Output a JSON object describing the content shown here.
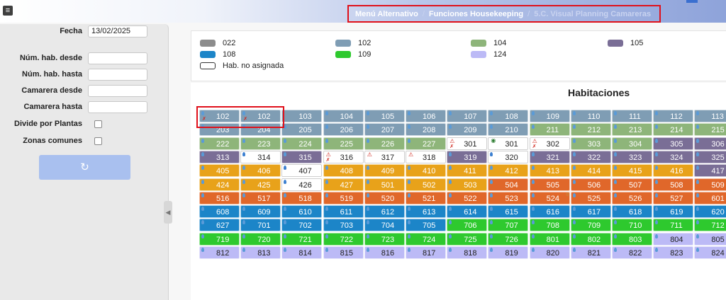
{
  "header": {
    "menu_icon": "hamburger-icon",
    "breadcrumb": [
      "Menú Alternativo",
      "Funciones Housekeeping",
      "5.C. Visual Planning Camareras"
    ],
    "separator": "/"
  },
  "filters": {
    "fecha_label": "Fecha",
    "fecha_value": "13/02/2025",
    "hab_desde_label": "Núm. hab. desde",
    "hab_desde_value": "",
    "hab_hasta_label": "Núm. hab. hasta",
    "hab_hasta_value": "",
    "camarera_desde_label": "Camarera desde",
    "camarera_desde_value": "",
    "camarera_hasta_label": "Camarera hasta",
    "camarera_hasta_value": "",
    "divide_plantas_label": "Divide por Plantas",
    "divide_plantas_checked": false,
    "zonas_comunes_label": "Zonas comunes",
    "zonas_comunes_checked": false,
    "refresh_icon": "refresh-icon",
    "collapse_icon": "chevron-left-icon"
  },
  "legend": [
    {
      "code": "022",
      "color": "#8c8c8c"
    },
    {
      "code": "102",
      "color": "#7f9db4"
    },
    {
      "code": "104",
      "color": "#8eb57a"
    },
    {
      "code": "105",
      "color": "#7a6e96"
    },
    {
      "code": "108",
      "color": "#1c85c8"
    },
    {
      "code": "109",
      "color": "#2ec92e"
    },
    {
      "code": "124",
      "color": "#bcbaf6"
    },
    {
      "code": "Hab. no asignada",
      "color": "#ffffff"
    }
  ],
  "rooms_title": "Habitaciones",
  "palette": {
    "A": "#7f9db4",
    "G": "#8eb57a",
    "P": "#7a6e96",
    "W": "#ffffff",
    "O": "#e8a21a",
    "R": "#e0672a",
    "B": "#1c85c8",
    "N": "#2ec92e",
    "L": "#bcbaf6"
  },
  "rooms": [
    [
      [
        "102",
        "A",
        "dp"
      ],
      [
        "102",
        "A",
        "dp"
      ],
      [
        "103",
        "A",
        ""
      ],
      [
        "104",
        "A",
        "d"
      ],
      [
        "105",
        "A",
        "d"
      ],
      [
        "106",
        "A",
        "d"
      ],
      [
        "107",
        "A",
        "d"
      ],
      [
        "108",
        "A",
        "d"
      ],
      [
        "109",
        "A",
        "d"
      ],
      [
        "110",
        "A",
        "d"
      ],
      [
        "111",
        "A",
        "d"
      ],
      [
        "112",
        "A",
        "d"
      ],
      [
        "113",
        "A",
        "d"
      ]
    ],
    [
      [
        "203",
        "A",
        "d"
      ],
      [
        "204",
        "A",
        "d"
      ],
      [
        "205",
        "A",
        "d"
      ],
      [
        "206",
        "A",
        "d"
      ],
      [
        "207",
        "A",
        "d"
      ],
      [
        "208",
        "A",
        "d"
      ],
      [
        "209",
        "A",
        "d"
      ],
      [
        "210",
        "A",
        "d"
      ],
      [
        "211",
        "G",
        "d"
      ],
      [
        "212",
        "G",
        "d"
      ],
      [
        "213",
        "G",
        "d"
      ],
      [
        "214",
        "G",
        "d"
      ],
      [
        "215",
        "G",
        "d"
      ]
    ],
    [
      [
        "222",
        "G",
        "d"
      ],
      [
        "223",
        "G",
        "d"
      ],
      [
        "224",
        "G",
        "d"
      ],
      [
        "225",
        "G",
        "d"
      ],
      [
        "226",
        "G",
        "d"
      ],
      [
        "227",
        "G",
        "d"
      ],
      [
        "301",
        "W",
        "wp"
      ],
      [
        "301",
        "W",
        "e"
      ],
      [
        "302",
        "W",
        "wp"
      ],
      [
        "303",
        "G",
        "d"
      ],
      [
        "304",
        "G",
        "d"
      ],
      [
        "305",
        "P",
        "d"
      ],
      [
        "306",
        "P",
        "d"
      ]
    ],
    [
      [
        "313",
        "P",
        "d"
      ],
      [
        "314",
        "W",
        "d"
      ],
      [
        "315",
        "P",
        "d"
      ],
      [
        "316",
        "W",
        "wp"
      ],
      [
        "317",
        "W",
        "w"
      ],
      [
        "318",
        "W",
        "w"
      ],
      [
        "319",
        "P",
        "d"
      ],
      [
        "320",
        "W",
        "d"
      ],
      [
        "321",
        "P",
        "d"
      ],
      [
        "322",
        "P",
        "d"
      ],
      [
        "323",
        "P",
        "d"
      ],
      [
        "324",
        "P",
        "d"
      ],
      [
        "325",
        "P",
        "d"
      ]
    ],
    [
      [
        "405",
        "O",
        "d"
      ],
      [
        "406",
        "O",
        "d"
      ],
      [
        "407",
        "W",
        "d"
      ],
      [
        "408",
        "O",
        "d"
      ],
      [
        "409",
        "O",
        "d"
      ],
      [
        "410",
        "O",
        "d"
      ],
      [
        "411",
        "O",
        "d"
      ],
      [
        "412",
        "O",
        "d"
      ],
      [
        "413",
        "O",
        "d"
      ],
      [
        "414",
        "O",
        "d"
      ],
      [
        "415",
        "O",
        "d"
      ],
      [
        "416",
        "O",
        "d"
      ],
      [
        "417",
        "P",
        "d"
      ]
    ],
    [
      [
        "424",
        "O",
        "d"
      ],
      [
        "425",
        "O",
        "d"
      ],
      [
        "426",
        "W",
        "d"
      ],
      [
        "427",
        "O",
        "d"
      ],
      [
        "501",
        "O",
        "d"
      ],
      [
        "502",
        "O",
        "d"
      ],
      [
        "503",
        "O",
        "d"
      ],
      [
        "504",
        "R",
        "d"
      ],
      [
        "505",
        "R",
        "d"
      ],
      [
        "506",
        "R",
        "d"
      ],
      [
        "507",
        "R",
        "d"
      ],
      [
        "508",
        "R",
        "d"
      ],
      [
        "509",
        "R",
        "d"
      ]
    ],
    [
      [
        "516",
        "R",
        "d"
      ],
      [
        "517",
        "R",
        "d"
      ],
      [
        "518",
        "R",
        "d"
      ],
      [
        "519",
        "R",
        "d"
      ],
      [
        "520",
        "R",
        "d"
      ],
      [
        "521",
        "R",
        "d"
      ],
      [
        "522",
        "R",
        "d"
      ],
      [
        "523",
        "R",
        "d"
      ],
      [
        "524",
        "R",
        "dg"
      ],
      [
        "525",
        "R",
        "d"
      ],
      [
        "526",
        "R",
        "d"
      ],
      [
        "527",
        "R",
        "d"
      ],
      [
        "601",
        "R",
        "d"
      ]
    ],
    [
      [
        "608",
        "B",
        "d"
      ],
      [
        "609",
        "B",
        "d"
      ],
      [
        "610",
        "B",
        "d"
      ],
      [
        "611",
        "B",
        "d"
      ],
      [
        "612",
        "B",
        "d"
      ],
      [
        "613",
        "B",
        "d"
      ],
      [
        "614",
        "B",
        "d"
      ],
      [
        "615",
        "B",
        "d"
      ],
      [
        "616",
        "B",
        "d"
      ],
      [
        "617",
        "B",
        "d"
      ],
      [
        "618",
        "B",
        "d"
      ],
      [
        "619",
        "B",
        "d"
      ],
      [
        "620",
        "B",
        "d"
      ]
    ],
    [
      [
        "627",
        "B",
        "d"
      ],
      [
        "701",
        "B",
        "d"
      ],
      [
        "702",
        "B",
        "d"
      ],
      [
        "703",
        "B",
        "d"
      ],
      [
        "704",
        "B",
        "d"
      ],
      [
        "705",
        "B",
        "d"
      ],
      [
        "706",
        "N",
        "d"
      ],
      [
        "707",
        "N",
        "d"
      ],
      [
        "708",
        "N",
        "d"
      ],
      [
        "709",
        "N",
        "d"
      ],
      [
        "710",
        "N",
        "d"
      ],
      [
        "711",
        "N",
        "d"
      ],
      [
        "712",
        "N",
        "d"
      ]
    ],
    [
      [
        "719",
        "N",
        "d"
      ],
      [
        "720",
        "N",
        "d"
      ],
      [
        "721",
        "N",
        "d"
      ],
      [
        "722",
        "N",
        "d"
      ],
      [
        "723",
        "N",
        "d"
      ],
      [
        "724",
        "N",
        "d"
      ],
      [
        "725",
        "N",
        "d"
      ],
      [
        "726",
        "N",
        "d"
      ],
      [
        "801",
        "N",
        "d"
      ],
      [
        "802",
        "N",
        "d"
      ],
      [
        "803",
        "N",
        "d"
      ],
      [
        "804",
        "L",
        "d"
      ],
      [
        "805",
        "L",
        "d"
      ]
    ],
    [
      [
        "812",
        "L",
        "d"
      ],
      [
        "813",
        "L",
        "d"
      ],
      [
        "814",
        "L",
        "d"
      ],
      [
        "815",
        "L",
        "d"
      ],
      [
        "816",
        "L",
        "d"
      ],
      [
        "817",
        "L",
        "d"
      ],
      [
        "818",
        "L",
        "d"
      ],
      [
        "819",
        "L",
        "d"
      ],
      [
        "820",
        "L",
        "d"
      ],
      [
        "821",
        "L",
        "d"
      ],
      [
        "822",
        "L",
        "d"
      ],
      [
        "823",
        "L",
        "d"
      ],
      [
        "824",
        "L",
        "d"
      ]
    ]
  ]
}
